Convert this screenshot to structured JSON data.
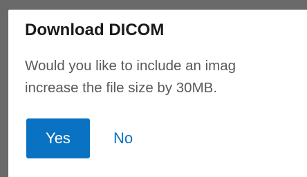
{
  "dialog": {
    "title": "Download DICOM",
    "message_line1": "Would you like to include an imag",
    "message_line2": "increase the file size by 30MB.",
    "yes_label": "Yes",
    "no_label": "No"
  },
  "colors": {
    "primary": "#0a72c2",
    "overlay": "#6a6a6a",
    "text_muted": "#5a5a5a"
  }
}
